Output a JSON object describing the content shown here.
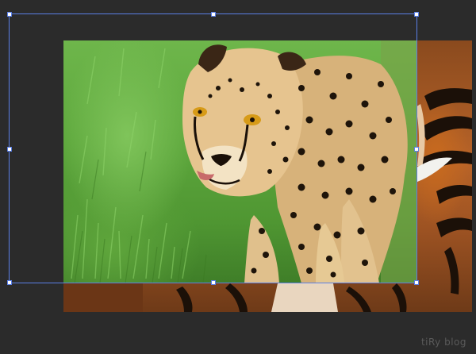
{
  "canvas": {
    "background_color": "#2b2b2b",
    "frame_color": "#5b7fe6"
  },
  "layers": {
    "photo_subject": "cheetah",
    "background_subject": "tiger"
  },
  "watermark": {
    "text": "tiRy blog"
  }
}
